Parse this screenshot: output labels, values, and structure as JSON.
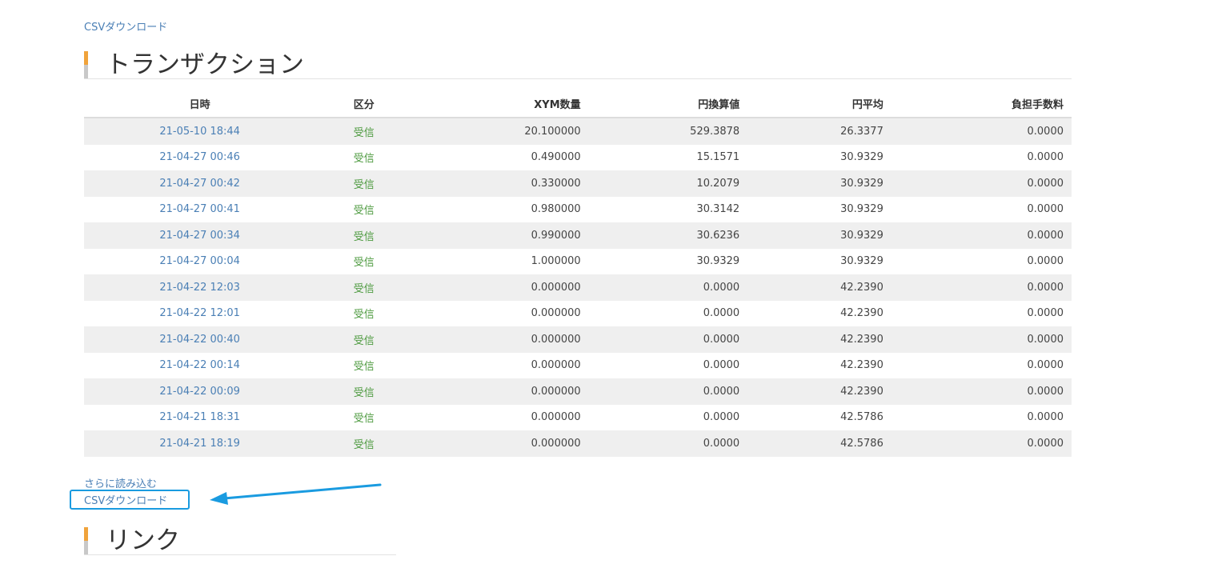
{
  "top_link": {
    "label": "CSVダウンロード"
  },
  "transactions_section": {
    "title": "トランザクション"
  },
  "table": {
    "headers": {
      "date": "日時",
      "kind": "区分",
      "xym_qty": "XYM数量",
      "jpy_value": "円換算値",
      "jpy_avg": "円平均",
      "fee": "負担手数料"
    },
    "rows": [
      {
        "date": "21-05-10 18:44",
        "kind": "受信",
        "xym_qty": "20.100000",
        "jpy_value": "529.3878",
        "jpy_avg": "26.3377",
        "fee": "0.0000"
      },
      {
        "date": "21-04-27 00:46",
        "kind": "受信",
        "xym_qty": "0.490000",
        "jpy_value": "15.1571",
        "jpy_avg": "30.9329",
        "fee": "0.0000"
      },
      {
        "date": "21-04-27 00:42",
        "kind": "受信",
        "xym_qty": "0.330000",
        "jpy_value": "10.2079",
        "jpy_avg": "30.9329",
        "fee": "0.0000"
      },
      {
        "date": "21-04-27 00:41",
        "kind": "受信",
        "xym_qty": "0.980000",
        "jpy_value": "30.3142",
        "jpy_avg": "30.9329",
        "fee": "0.0000"
      },
      {
        "date": "21-04-27 00:34",
        "kind": "受信",
        "xym_qty": "0.990000",
        "jpy_value": "30.6236",
        "jpy_avg": "30.9329",
        "fee": "0.0000"
      },
      {
        "date": "21-04-27 00:04",
        "kind": "受信",
        "xym_qty": "1.000000",
        "jpy_value": "30.9329",
        "jpy_avg": "30.9329",
        "fee": "0.0000"
      },
      {
        "date": "21-04-22 12:03",
        "kind": "受信",
        "xym_qty": "0.000000",
        "jpy_value": "0.0000",
        "jpy_avg": "42.2390",
        "fee": "0.0000"
      },
      {
        "date": "21-04-22 12:01",
        "kind": "受信",
        "xym_qty": "0.000000",
        "jpy_value": "0.0000",
        "jpy_avg": "42.2390",
        "fee": "0.0000"
      },
      {
        "date": "21-04-22 00:40",
        "kind": "受信",
        "xym_qty": "0.000000",
        "jpy_value": "0.0000",
        "jpy_avg": "42.2390",
        "fee": "0.0000"
      },
      {
        "date": "21-04-22 00:14",
        "kind": "受信",
        "xym_qty": "0.000000",
        "jpy_value": "0.0000",
        "jpy_avg": "42.2390",
        "fee": "0.0000"
      },
      {
        "date": "21-04-22 00:09",
        "kind": "受信",
        "xym_qty": "0.000000",
        "jpy_value": "0.0000",
        "jpy_avg": "42.2390",
        "fee": "0.0000"
      },
      {
        "date": "21-04-21 18:31",
        "kind": "受信",
        "xym_qty": "0.000000",
        "jpy_value": "0.0000",
        "jpy_avg": "42.5786",
        "fee": "0.0000"
      },
      {
        "date": "21-04-21 18:19",
        "kind": "受信",
        "xym_qty": "0.000000",
        "jpy_value": "0.0000",
        "jpy_avg": "42.5786",
        "fee": "0.0000"
      }
    ]
  },
  "load_more": {
    "label": "さらに読み込む"
  },
  "bottom_link": {
    "label": "CSVダウンロード"
  },
  "annotation": {
    "highlight_color": "#1a9be0"
  },
  "links_section": {
    "title": "リンク"
  },
  "colors": {
    "link": "#4a7fb5",
    "kind_text": "#4d9a3f",
    "accent_bar": "#f0a33b",
    "row_stripe": "#efefef"
  }
}
